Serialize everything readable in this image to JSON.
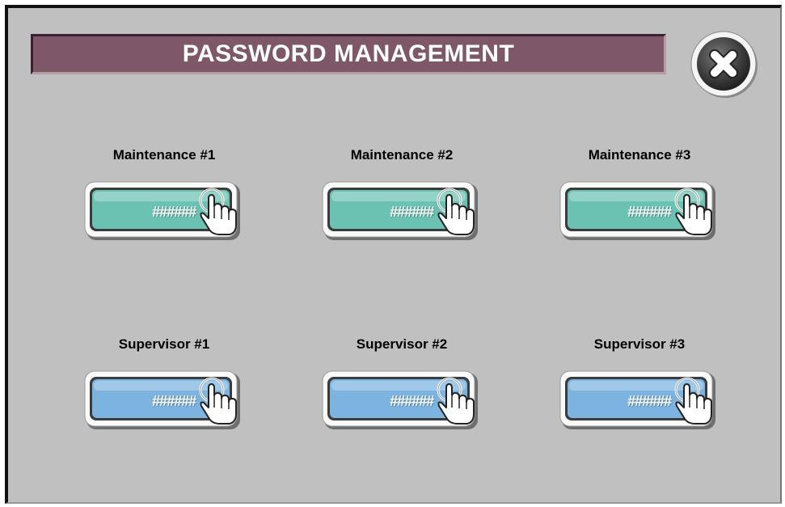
{
  "title": "PASSWORD MANAGEMENT",
  "close_button": {
    "icon": "close-icon"
  },
  "colors": {
    "background": "#c0c0c0",
    "title_bar": "#7e5868",
    "maintenance_button": "#6cc2b2",
    "supervisor_button": "#7cb3df"
  },
  "accounts": [
    {
      "label": "Maintenance #1",
      "masked": "######",
      "group": "maintenance"
    },
    {
      "label": "Maintenance #2",
      "masked": "######",
      "group": "maintenance"
    },
    {
      "label": "Maintenance #3",
      "masked": "######",
      "group": "maintenance"
    },
    {
      "label": "Supervisor #1",
      "masked": "######",
      "group": "supervisor"
    },
    {
      "label": "Supervisor #2",
      "masked": "######",
      "group": "supervisor"
    },
    {
      "label": "Supervisor #3",
      "masked": "######",
      "group": "supervisor"
    }
  ]
}
